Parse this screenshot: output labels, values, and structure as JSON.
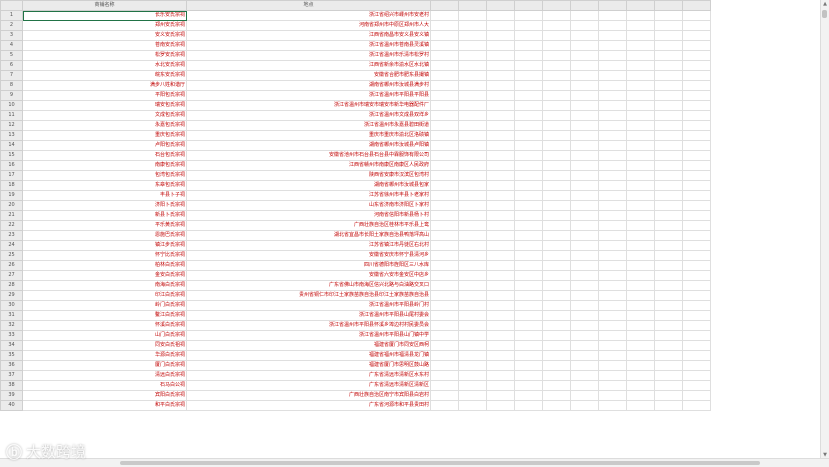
{
  "headers": {
    "col_name": "商铺名称",
    "col_location": "地点"
  },
  "rows": [
    {
      "num": "1",
      "name": "长乐安氏宗祠",
      "loc": "浙江省绍兴市嵊州市安老村"
    },
    {
      "num": "2",
      "name": "郑州安氏宗祠",
      "loc": "河南省郑州市中原区郑州市人大"
    },
    {
      "num": "3",
      "name": "安义安氏宗祠",
      "loc": "江西省南昌市安义县安义镇"
    },
    {
      "num": "4",
      "name": "苍南安氏宗祠",
      "loc": "浙江省温州市苍南县灵溪镇"
    },
    {
      "num": "5",
      "name": "松罗安氏宗祠",
      "loc": "浙江省温州市乐清市松罗村"
    },
    {
      "num": "6",
      "name": "水北安氏宗祠",
      "loc": "江西省新余市渝水区水北镇"
    },
    {
      "num": "7",
      "name": "皖东安氏宗祠",
      "loc": "安徽省合肥市肥东县撮镇"
    },
    {
      "num": "8",
      "name": "满步八姓和谐厅",
      "loc": "湖南省郴州市汝城县满步村"
    },
    {
      "num": "9",
      "name": "平阳包氏宗祠",
      "loc": "浙江省温州市平阳县平阳县"
    },
    {
      "num": "10",
      "name": "瑞安包氏宗祠",
      "loc": "浙江省温州市瑞安市瑞安市新华电器配件厂"
    },
    {
      "num": "11",
      "name": "文成包氏宗祠",
      "loc": "浙江省温州市文成县双垟乡"
    },
    {
      "num": "12",
      "name": "永嘉包氏宗祠",
      "loc": "浙江省温州市永嘉县碧田街道"
    },
    {
      "num": "13",
      "name": "重庆包氏宗祠",
      "loc": "重庆市重庆市渝北区洛碛镇"
    },
    {
      "num": "14",
      "name": "卢阳包氏宗祠",
      "loc": "湖南省郴州市汝城县卢阳镇"
    },
    {
      "num": "15",
      "name": "石台包氏宗祠",
      "loc": "安徽省池州市石台县石台县中霖服饰有限公司"
    },
    {
      "num": "16",
      "name": "南康包氏宗祠",
      "loc": "江西省赣州市南康区南康区人民政府"
    },
    {
      "num": "17",
      "name": "包湾包氏宗祠",
      "loc": "陕西省安康市汉滨区包湾村"
    },
    {
      "num": "18",
      "name": "东皋包氏宗祠",
      "loc": "湖南省郴州市汝城县包家"
    },
    {
      "num": "19",
      "name": "丰县卜子祠",
      "loc": "江苏省徐州市丰县卜老家村"
    },
    {
      "num": "20",
      "name": "济阳卜氏宗祠",
      "loc": "山东省济南市济阳区卜家村"
    },
    {
      "num": "21",
      "name": "新县卜氏宗祠",
      "loc": "河南省信阳市新县杨卜村"
    },
    {
      "num": "22",
      "name": "平乐黄氏宗祠",
      "loc": "广西壮族自治区桂林市平乐县上鸾"
    },
    {
      "num": "23",
      "name": "恩施巴氏宗祠",
      "loc": "湖北省宜昌市长阳土家族自治县鸭落坪高山"
    },
    {
      "num": "24",
      "name": "镇江步氏宗祠",
      "loc": "江苏省镇江市丹徒区右北村"
    },
    {
      "num": "25",
      "name": "怀宁比氏宗祠",
      "loc": "安徽省安庆市怀宁县清河乡"
    },
    {
      "num": "26",
      "name": "柏林白氏宗祠",
      "loc": "四川省德阳市旌阳区三八水库"
    },
    {
      "num": "27",
      "name": "金安白氏宗祠",
      "loc": "安徽省六安市金安区中店乡"
    },
    {
      "num": "28",
      "name": "南海白氏宗祠",
      "loc": "广东省佛山市南海区信兴北路与白油路交叉口"
    },
    {
      "num": "29",
      "name": "印江白氏宗祠",
      "loc": "贵州省铜仁市印江土家族苗族自治县印江土家族苗族自治县"
    },
    {
      "num": "30",
      "name": "岭门白氏宗祠",
      "loc": "浙江省温州市平阳县岭门村"
    },
    {
      "num": "31",
      "name": "鳌江白氏宗祠",
      "loc": "浙江省温州市平阳县山尾村委会"
    },
    {
      "num": "32",
      "name": "怀溪白氏宗祠",
      "loc": "浙江省温州市平阳县怀溪乡埠边村村民委员会"
    },
    {
      "num": "33",
      "name": "山门白氏宗祠",
      "loc": "浙江省温州市平阳县山门镇中学"
    },
    {
      "num": "34",
      "name": "同安白氏祖祠",
      "loc": "福建省厦门市同安区西柯"
    },
    {
      "num": "35",
      "name": "华源白氏宗祠",
      "loc": "福建省福州市福清县龙门镇"
    },
    {
      "num": "36",
      "name": "厦门白氏宗祠",
      "loc": "福建省厦门市思明区鼓山路"
    },
    {
      "num": "37",
      "name": "清远白氏宗祠",
      "loc": "广东省清远市清新区水东村"
    },
    {
      "num": "38",
      "name": "石马白公祠",
      "loc": "广东省清远市清新区清新区"
    },
    {
      "num": "39",
      "name": "宾阳白氏宗祠",
      "loc": "广西壮族自治区南宁市宾阳县白岩村"
    },
    {
      "num": "40",
      "name": "和平白氏宗祠",
      "loc": "广东省河源市和平县贵田村"
    }
  ],
  "extra_column_count": 10,
  "watermark": {
    "logo": "ⓑ",
    "text": "大数跨境"
  }
}
